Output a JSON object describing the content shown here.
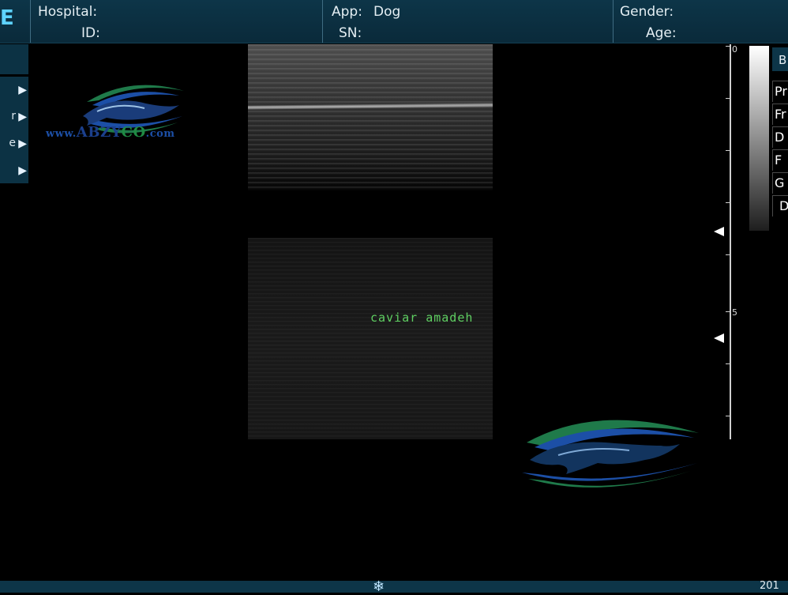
{
  "header": {
    "logo_fragment": "E",
    "hospital_label": "Hospital:",
    "id_label": "ID:",
    "app_label": "App:",
    "app_value": "Dog",
    "sn_label": "SN:",
    "gender_label": "Gender:",
    "age_label": "Age:"
  },
  "left_menu": {
    "items": [
      {
        "label": "",
        "arrow": "▶"
      },
      {
        "label": "r",
        "arrow": "▶"
      },
      {
        "label": "e",
        "arrow": "▶"
      },
      {
        "label": "",
        "arrow": "▶"
      }
    ]
  },
  "image": {
    "annotation": "caviar amadeh"
  },
  "depth_scale": {
    "labels": [
      "0",
      "5"
    ],
    "focus_markers": 2
  },
  "right_panel": {
    "header": "B",
    "items": [
      "Pr",
      "Fr",
      "D",
      "F",
      "G",
      "D"
    ]
  },
  "watermark": {
    "text_www": "www.",
    "text_brand_blue": "ABZY",
    "text_brand_green": "CO",
    "text_com": ".com"
  },
  "bottom_bar": {
    "freeze_icon": "snowflake-icon",
    "text": "201"
  },
  "colors": {
    "header_bg": "#0d3548",
    "annotation": "#5fcf62",
    "logo_blue": "#1c4fa6",
    "logo_green": "#1f8a43"
  }
}
